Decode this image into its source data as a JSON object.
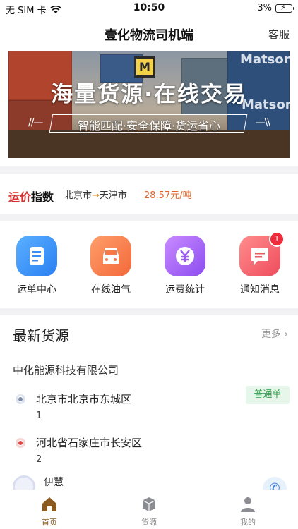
{
  "status": {
    "carrier": "无 SIM 卡",
    "time": "10:50",
    "battery": "3%"
  },
  "nav": {
    "title": "壹化物流司机端",
    "service": "客服"
  },
  "banner": {
    "headline": "海量货源·在线交易",
    "subline": "智能匹配·安全保障·货运省心",
    "deco_left": "//—",
    "deco_right": "—\\\\",
    "brand_text": "Matson",
    "logo_letter": "M"
  },
  "price_index": {
    "brand_prefix": "运价",
    "brand_suffix": "指数",
    "from": "北京市",
    "arrow": "→",
    "to": "天津市",
    "price": "28.57元/吨"
  },
  "quick_actions": [
    {
      "label": "运单中心",
      "icon": "document-list-icon"
    },
    {
      "label": "在线油气",
      "icon": "car-icon"
    },
    {
      "label": "运费统计",
      "icon": "yen-icon"
    },
    {
      "label": "通知消息",
      "icon": "message-icon",
      "badge": "1"
    }
  ],
  "cargo": {
    "title": "最新货源",
    "more": "更多 ›",
    "company": "中化能源科技有限公司",
    "tag": "普通单",
    "stops": [
      {
        "address": "北京市北京市东城区",
        "count": "1"
      },
      {
        "address": "河北省石家庄市长安区",
        "count": "2"
      }
    ],
    "contact_name": "伊慧"
  },
  "tabs": [
    {
      "label": "首页",
      "active": true
    },
    {
      "label": "货源",
      "active": false
    },
    {
      "label": "我的",
      "active": false
    }
  ],
  "colors": {
    "accent": "#8a5a20",
    "price": "#e0672d",
    "tag_green": "#2c9c4a",
    "badge_red": "#ec2b3b"
  }
}
